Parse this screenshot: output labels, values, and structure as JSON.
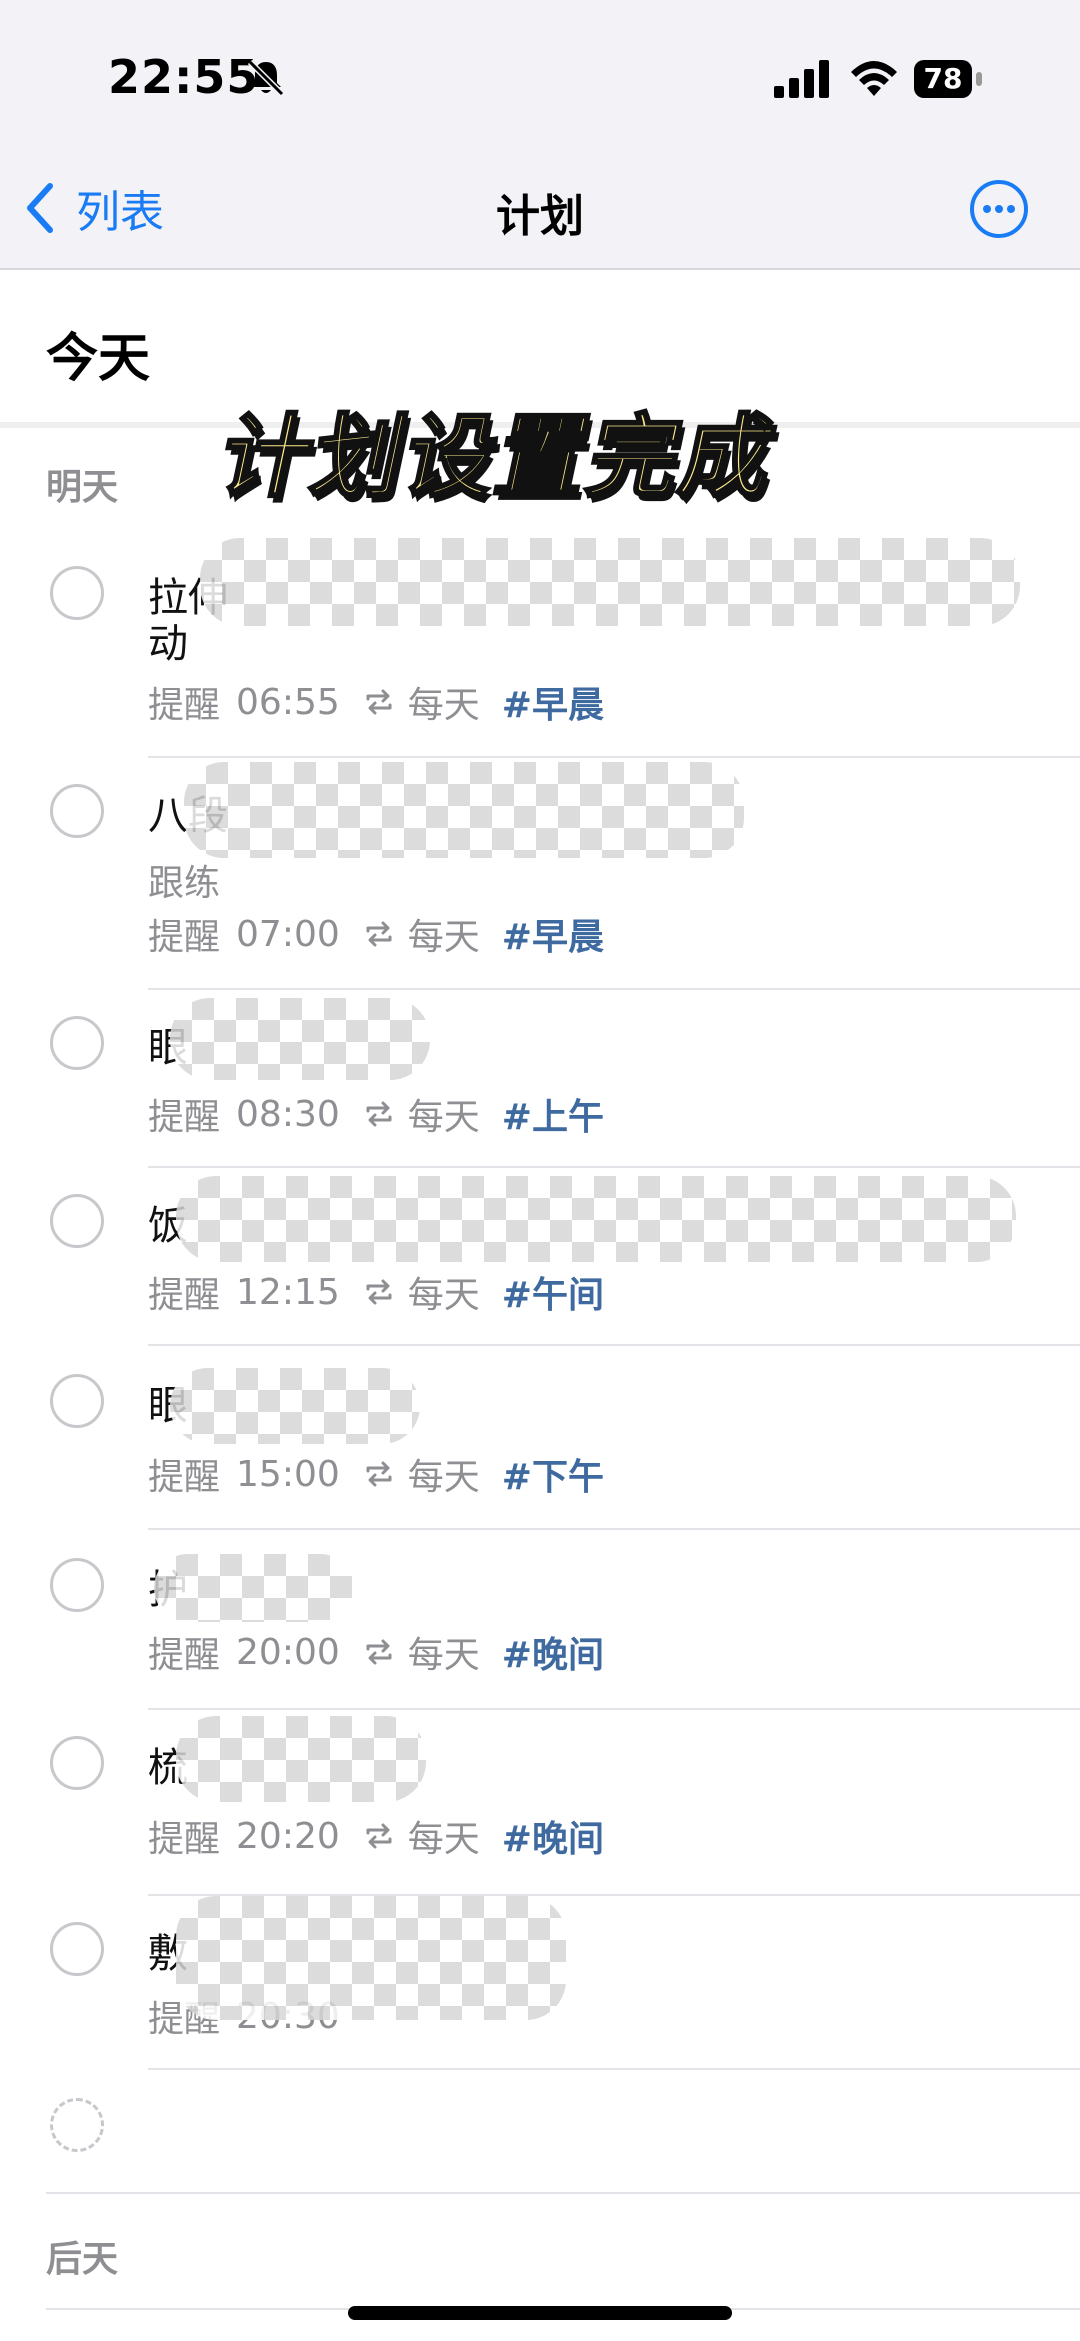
{
  "status": {
    "time": "22:55",
    "battery": "78"
  },
  "nav": {
    "back_label": "列表",
    "title": "计划"
  },
  "today_label": "今天",
  "overlay_text": "计划设置完成",
  "sections": {
    "tomorrow": "明天",
    "day_after": "后天"
  },
  "reminder_label": "提醒",
  "repeat_label": "每天",
  "tasks": [
    {
      "title_visible": "拉伸",
      "title_line2": "动",
      "time": "06:55",
      "tag": "#早晨"
    },
    {
      "title_visible": "八段",
      "note": "跟练",
      "time": "07:00",
      "tag": "#早晨"
    },
    {
      "title_visible": "眼",
      "time": "08:30",
      "tag": "#上午"
    },
    {
      "title_visible": "饭",
      "time": "12:15",
      "tag": "#午间"
    },
    {
      "title_visible": "眼",
      "time": "15:00",
      "tag": "#下午"
    },
    {
      "title_visible": "护",
      "time": "20:00",
      "tag": "#晚间"
    },
    {
      "title_visible": "梳",
      "time": "20:20",
      "tag": "#晚间"
    },
    {
      "title_visible": "敷",
      "time": "20:30"
    }
  ]
}
